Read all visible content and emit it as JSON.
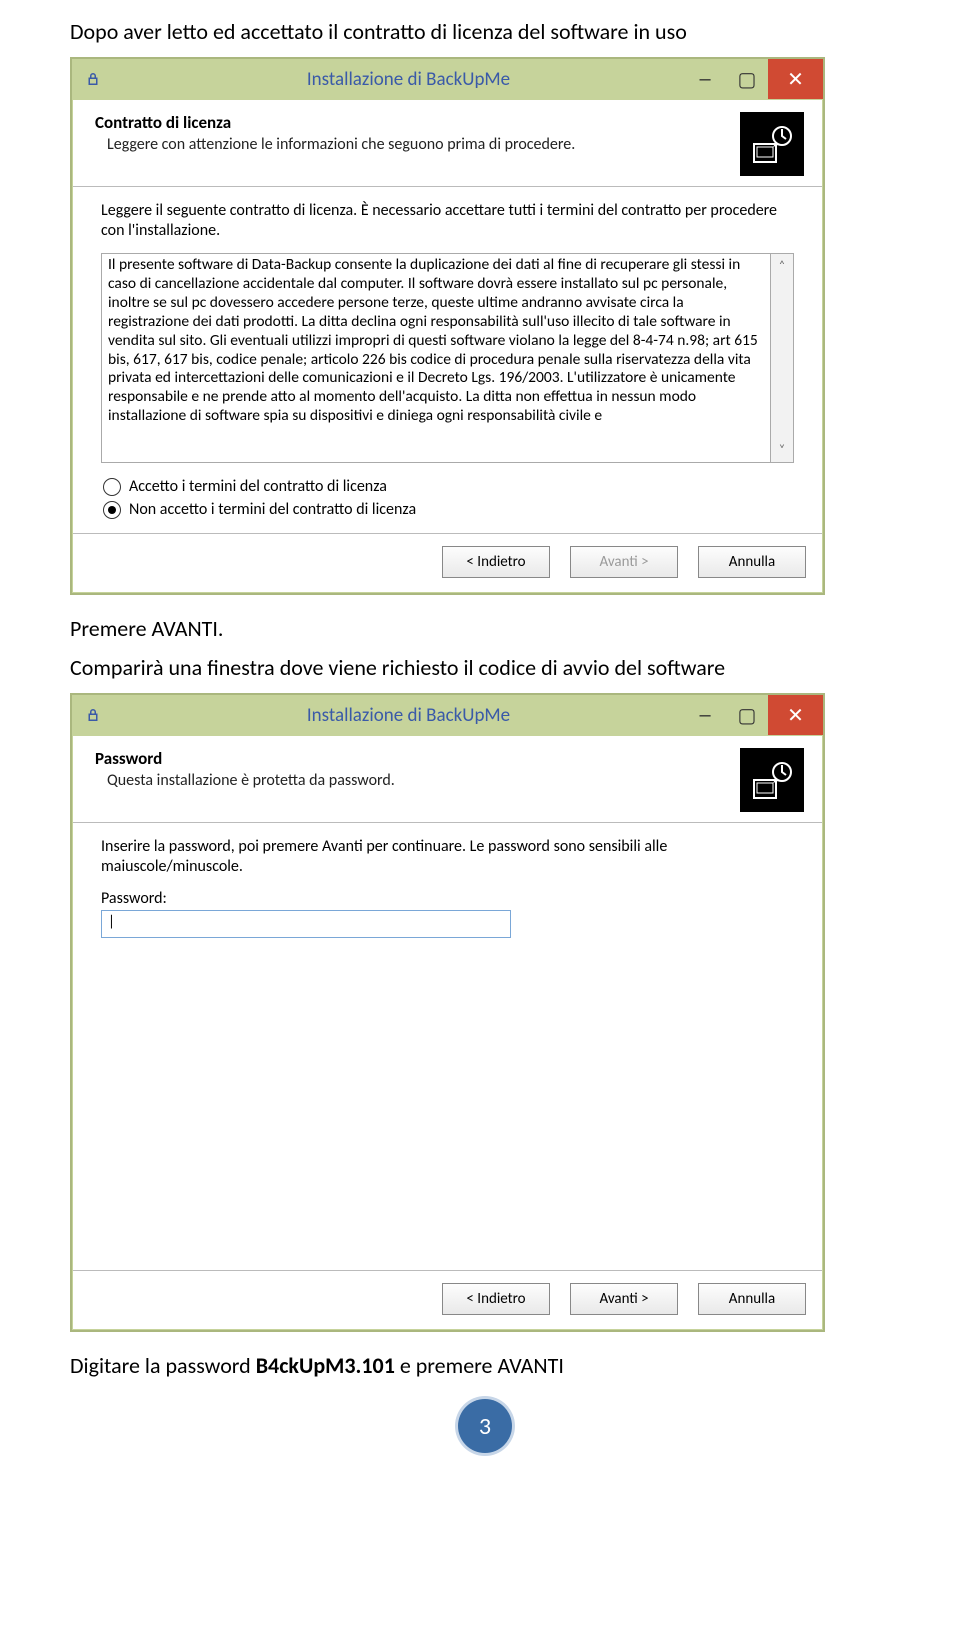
{
  "doc": {
    "line1": "Dopo aver letto ed accettato il contratto di licenza del software in uso",
    "line2": "Premere AVANTI.",
    "line3": "Comparirà una finestra dove viene richiesto il codice di avvio del software",
    "final_prefix": "Digitare la password ",
    "final_pw": "B4ckUpM3.101",
    "final_suffix": " e premere AVANTI",
    "page": "3"
  },
  "win1": {
    "title": "Installazione di BackUpMe",
    "header_title": "Contratto di licenza",
    "header_sub": "Leggere con attenzione le informazioni che seguono prima di procedere.",
    "intro": "Leggere il seguente contratto di licenza. È necessario accettare tutti i termini del contratto per procedere con l'installazione.",
    "license": "Il presente software di Data-Backup consente la duplicazione dei dati al fine di recuperare gli stessi in caso di cancellazione accidentale dal computer. Il software dovrà essere installato sul pc personale, inoltre se sul pc dovessero accedere persone terze, queste ultime andranno avvisate circa la registrazione dei dati prodotti. La ditta declina ogni responsabilità sull'uso illecito di tale software in vendita sul sito. Gli eventuali utilizzi impropri di questi software violano la legge del 8-4-74 n.98; art 615 bis, 617, 617 bis, codice penale; articolo 226 bis codice di procedura penale sulla riservatezza della vita privata ed intercettazioni delle comunicazioni e il Decreto Lgs. 196/2003. L'utilizzatore è unicamente responsabile e ne prende atto al momento dell'acquisto. La ditta non effettua in nessun modo installazione di software spia su dispositivi e diniega ogni responsabilità civile e",
    "accept": "Accetto i termini del contratto di licenza",
    "reject": "Non accetto i termini del contratto di licenza",
    "btn_back": "<  Indietro",
    "btn_next": "Avanti  >",
    "btn_cancel": "Annulla"
  },
  "win2": {
    "title": "Installazione di BackUpMe",
    "header_title": "Password",
    "header_sub": "Questa installazione è protetta da password.",
    "intro": "Inserire la password, poi premere Avanti per continuare. Le password sono sensibili alle maiuscole/minuscole.",
    "pw_label": "Password:",
    "pw_value": "|",
    "btn_back": "<  Indietro",
    "btn_next": "Avanti  >",
    "btn_cancel": "Annulla"
  }
}
